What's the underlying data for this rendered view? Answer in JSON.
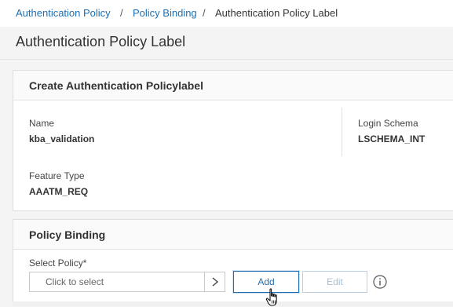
{
  "breadcrumb": {
    "items": [
      {
        "label": "Authentication Policy"
      },
      {
        "label": "Policy Binding"
      }
    ],
    "separator": "/",
    "current": "Authentication Policy Label"
  },
  "page": {
    "title": "Authentication Policy Label"
  },
  "create_panel": {
    "title": "Create Authentication Policylabel",
    "name_label": "Name",
    "name_value": "kba_validation",
    "schema_label": "Login Schema",
    "schema_value": "LSCHEMA_INT",
    "feature_label": "Feature Type",
    "feature_value": "AAATM_REQ"
  },
  "binding_panel": {
    "title": "Policy Binding",
    "select_label": "Select Policy*",
    "select_placeholder": "Click to select",
    "add_label": "Add",
    "edit_label": "Edit"
  },
  "colors": {
    "link": "#1f6fb2",
    "disabled": "#a8bfd4",
    "background": "#f4f4f4"
  },
  "icons": {
    "select_arrow": "chevron-right-icon",
    "info": "info-icon",
    "cursor": "hand-pointer-icon"
  }
}
